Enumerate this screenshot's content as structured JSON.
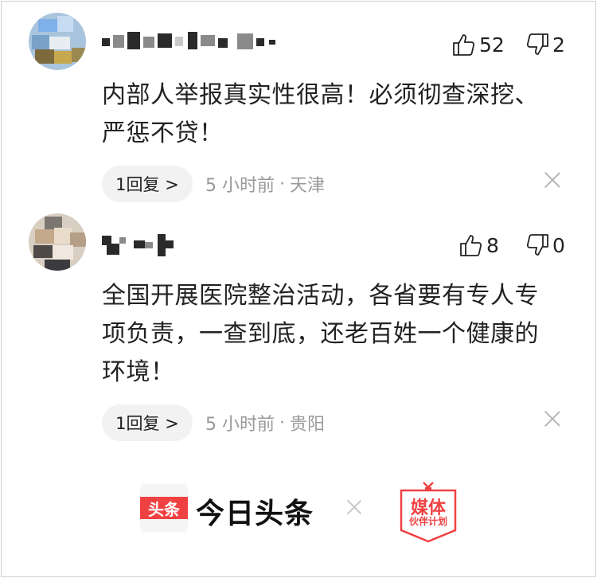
{
  "comments": [
    {
      "likes": "52",
      "dislikes": "2",
      "text_line1": "内部人举报真实性很高！必须彻查深挖、",
      "text_line2": "严惩不贷！",
      "reply_label": "1回复 >",
      "time": "5 小时前",
      "location": "天津"
    },
    {
      "likes": "8",
      "dislikes": "0",
      "text_line1": "全国开展医院整治活动，各省要有专人专",
      "text_line2": "项负责，一查到底，还老百姓一个健康的",
      "text_line3": "环境！",
      "reply_label": "1回复 >",
      "time": "5 小时前",
      "location": "贵阳"
    }
  ],
  "footer": {
    "app_badge": "头条",
    "app_name": "今日头条",
    "partner_title": "媒体",
    "partner_sub": "伙伴计划"
  },
  "colors": {
    "brand_red": "#f04142",
    "meta_gray": "#999999",
    "pill_bg": "#f2f2f2"
  },
  "icons": [
    "thumbs-up-icon",
    "thumbs-down-icon",
    "close-icon"
  ]
}
